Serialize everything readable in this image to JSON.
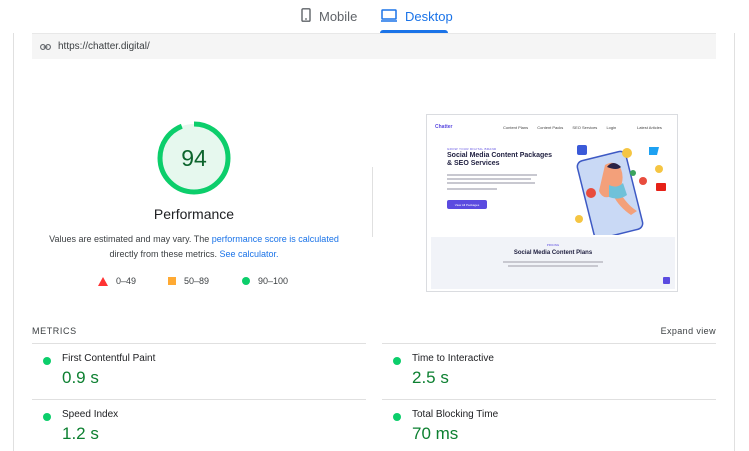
{
  "tabs": [
    {
      "label": "Mobile",
      "icon": "phone-icon",
      "active": false
    },
    {
      "label": "Desktop",
      "icon": "monitor-icon",
      "active": true
    }
  ],
  "url": "https://chatter.digital/",
  "performance": {
    "score": "94",
    "score_value": 94,
    "label": "Performance",
    "desc_prefix": "Values are estimated and may vary. The ",
    "desc_link1": "performance score is calculated",
    "desc_mid": " directly from these metrics. ",
    "desc_link2": "See calculator.",
    "gauge_color": "#0cce6b",
    "gauge_text_color": "#0d652d"
  },
  "legend": [
    {
      "range": "0–49",
      "shape": "triangle",
      "color": "#ff3333"
    },
    {
      "range": "50–89",
      "shape": "square",
      "color": "#ffaa33"
    },
    {
      "range": "90–100",
      "shape": "circle",
      "color": "#0cce6b"
    }
  ],
  "thumbnail": {
    "logo": "Chatter",
    "nav": [
      "Content Plans",
      "Content Packs",
      "SEO Services",
      "Login"
    ],
    "nav_right": "Latest Articles",
    "hero_sub": "GROW YOUR DIGITAL BRAND",
    "hero_title": "Social Media Content Packages & SEO Services",
    "hero_button": "View All Packages",
    "band_sub": "PRICING",
    "band_title": "Social Media Content Plans"
  },
  "metrics": {
    "title": "METRICS",
    "expand": "Expand view",
    "items": [
      {
        "name": "First Contentful Paint",
        "value": "0.9 s",
        "status_color": "#0cce6b"
      },
      {
        "name": "Time to Interactive",
        "value": "2.5 s",
        "status_color": "#0cce6b"
      },
      {
        "name": "Speed Index",
        "value": "1.2 s",
        "status_color": "#0cce6b"
      },
      {
        "name": "Total Blocking Time",
        "value": "70 ms",
        "status_color": "#0cce6b"
      }
    ]
  }
}
